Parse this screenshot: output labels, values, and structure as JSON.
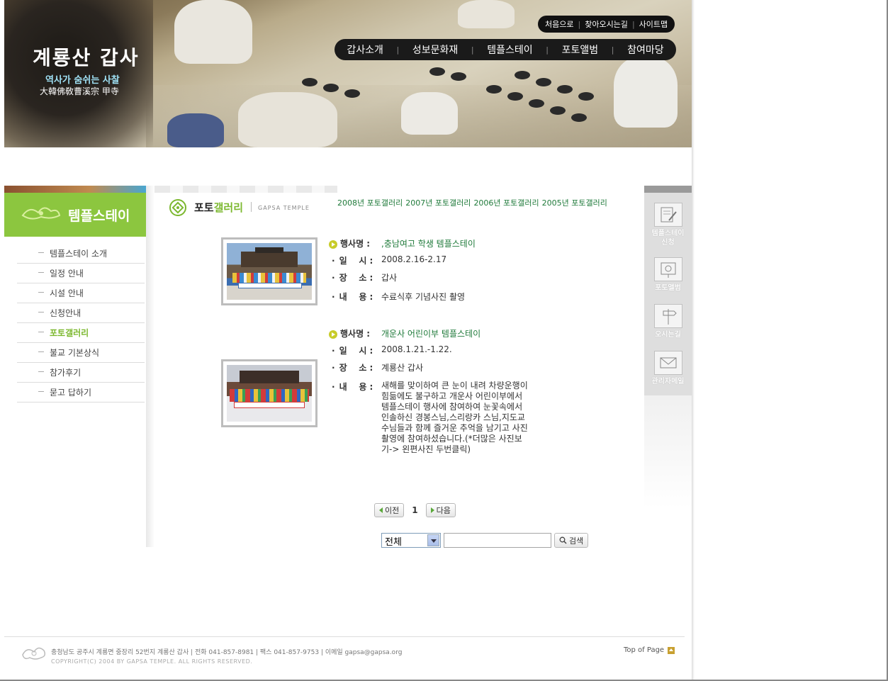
{
  "header": {
    "logo_title": "계룡산 갑사",
    "logo_slogan": "역사가 숨쉬는 사찰",
    "logo_subtitle": "大韓佛敎曹溪宗 甲寺",
    "util_links": [
      "처음으로",
      "찾아오시는길",
      "사이트맵"
    ],
    "gnb": [
      "갑사소개",
      "성보문화재",
      "템플스테이",
      "포토앨범",
      "참여마당"
    ]
  },
  "sidebar": {
    "title": "템플스테이",
    "items": [
      {
        "label": "템플스테이 소개"
      },
      {
        "label": "일정 안내"
      },
      {
        "label": "시설 안내"
      },
      {
        "label": "신청안내"
      },
      {
        "label": "포토갤러리",
        "active": true
      },
      {
        "label": "불교 기본상식"
      },
      {
        "label": "참가후기"
      },
      {
        "label": "묻고 답하기"
      }
    ]
  },
  "content": {
    "title_part1": "포토",
    "title_part2": "갤러리",
    "title_en": "GAPSA TEMPLE",
    "year_links": [
      "2008년 포토갤러리",
      "2007년 포토갤러리",
      "2006년 포토갤러리",
      "2005년 포토갤러리"
    ],
    "labels": {
      "event": "행사명 :",
      "date": "일    시 :",
      "place": "장    소 :",
      "desc": "내    용 :"
    },
    "items": [
      {
        "event": ",충남여고 학생 템플스테이",
        "date": "2008.2.16-2.17",
        "place": "갑사",
        "desc": "수료식후 기념사진 촬영"
      },
      {
        "event": "개운사 어린이부 템플스테이",
        "date": "2008.1.21.-1.22.",
        "place": "계룡산 갑사",
        "desc": "새해를 맞이하여 큰 눈이 내려 차량운행이 힘듦에도 불구하고 개운사 어린이부에서 템플스테이 행사에 참여하여 눈꽃속에서 인솔하신 경봉스님,스리랑카 스님,지도교수님들과 함께 즐거운 추억을 남기고 사진촬영에 참여하셨습니다.(*더많은 사진보기-> 왼편사진 두번클릭)"
      }
    ],
    "pager": {
      "prev": "이전",
      "page": "1",
      "next": "다음"
    },
    "search": {
      "select_value": "전체",
      "button": "검색",
      "input_value": ""
    }
  },
  "quick_menu": [
    {
      "label": "템플스테이\n신청",
      "icon": "pencil-note-icon"
    },
    {
      "label": "포토앨범",
      "icon": "photo-icon"
    },
    {
      "label": "오시는길",
      "icon": "signpost-icon"
    },
    {
      "label": "관리자메일",
      "icon": "mail-icon"
    }
  ],
  "footer": {
    "address": "충청남도 공주시 계룡면 중장리 52번지  계룡산 갑사  |  전화 041-857-8981  |  팩스 041-857-9753  |  이메일 gapsa@gapsa.org",
    "copyright": "COPYRIGHT(C) 2004 BY GAPSA TEMPLE. ALL RIGHTS RESERVED.",
    "top_of_page": "Top of Page"
  },
  "colors": {
    "accent_green": "#8cc63f",
    "link_green": "#1f7a3a",
    "quick_bg": "#dedede"
  }
}
